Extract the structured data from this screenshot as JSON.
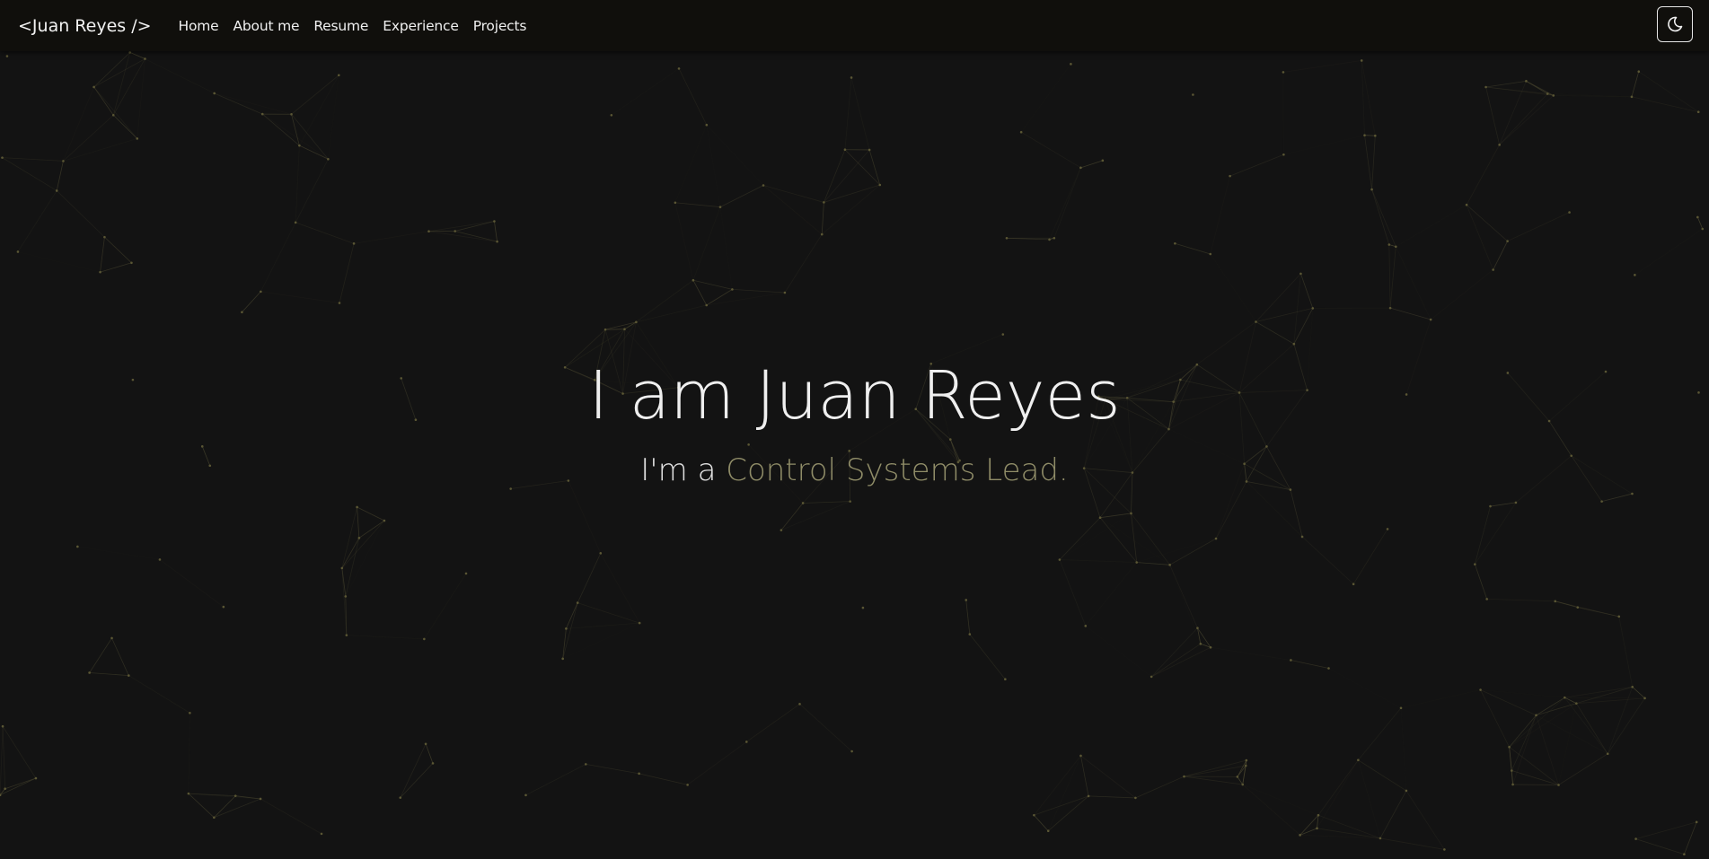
{
  "navbar": {
    "brand": "<Juan Reyes />",
    "links": [
      "Home",
      "About me",
      "Resume",
      "Experience",
      "Projects"
    ],
    "theme_toggle_icon": "moon-icon"
  },
  "hero": {
    "title": "I am Juan Reyes",
    "subtitle_prefix": "I'm a ",
    "subtitle_role": "Control Systems Lead."
  },
  "colors": {
    "background": "#131313",
    "navbar": "#100f0c",
    "accent": "#908d68",
    "particle_line": "#4a4730"
  }
}
